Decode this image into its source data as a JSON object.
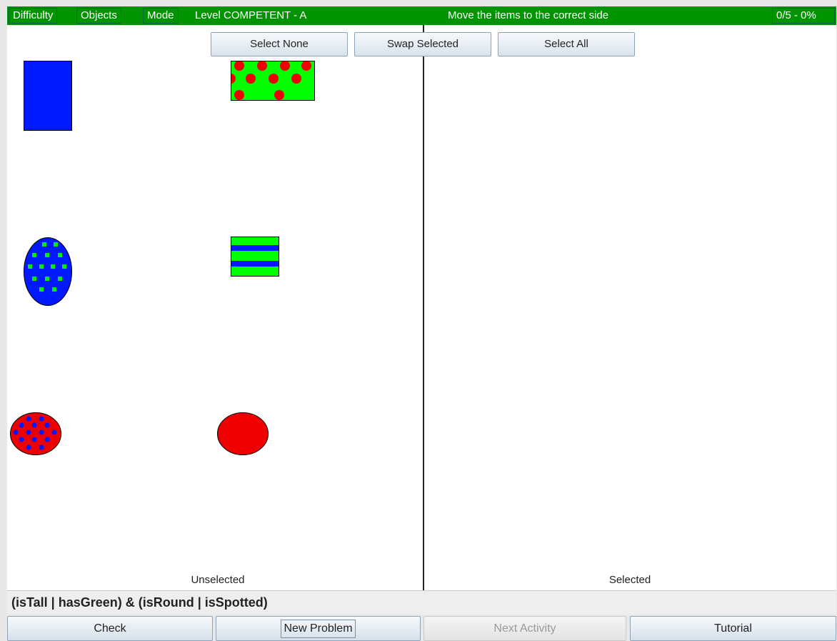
{
  "topbar": {
    "menu_difficulty": "Difficulty",
    "menu_objects": "Objects",
    "menu_mode": "Mode",
    "level": "Level COMPETENT - A",
    "instruction": "Move the items to the correct side",
    "score": "0/5 - 0%",
    "bar_color": "#009400"
  },
  "toolbar": {
    "select_none": "Select None",
    "swap_selected": "Swap Selected",
    "select_all": "Select All"
  },
  "panels": {
    "left_label": "Unselected",
    "right_label": "Selected"
  },
  "items_unselected": [
    {
      "shape": "rectangle",
      "orientation": "tall",
      "fill": "#0018ff",
      "pattern": "plain"
    },
    {
      "shape": "rectangle",
      "orientation": "wide",
      "fill": "#00ff00",
      "pattern": "spots",
      "pattern_color": "#ee0000"
    },
    {
      "shape": "ellipse",
      "orientation": "tall",
      "fill": "#0018ff",
      "pattern": "spots",
      "pattern_color": "#00ff00"
    },
    {
      "shape": "rectangle",
      "orientation": "square",
      "fill": "#00ff00",
      "pattern": "stripes",
      "pattern_color": "#0018ff"
    },
    {
      "shape": "ellipse",
      "orientation": "round",
      "fill": "#ee0000",
      "pattern": "spots",
      "pattern_color": "#0018ff"
    },
    {
      "shape": "ellipse",
      "orientation": "round",
      "fill": "#ee0000",
      "pattern": "plain"
    }
  ],
  "items_selected": [],
  "rule": "(isTall | hasGreen) & (isRound | isSpotted)",
  "bottom": {
    "check": "Check",
    "new_problem": "New Problem",
    "next_activity": "Next Activity",
    "tutorial": "Tutorial"
  }
}
